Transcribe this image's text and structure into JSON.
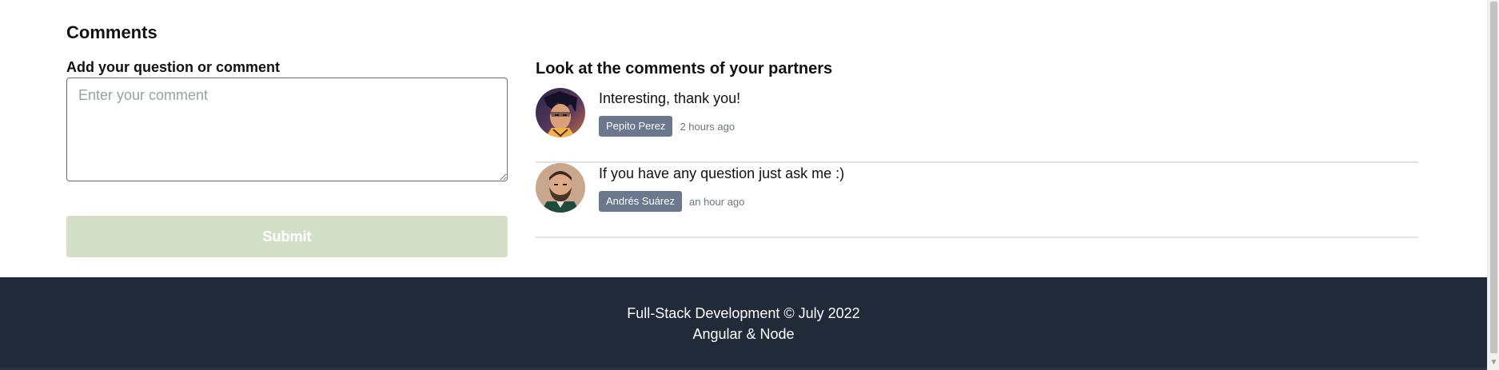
{
  "section": {
    "title": "Comments"
  },
  "form": {
    "label": "Add your question or comment",
    "placeholder": "Enter your comment",
    "value": "",
    "submit_label": "Submit"
  },
  "comments": {
    "heading": "Look at the comments of your partners",
    "items": [
      {
        "text": "Interesting, thank you!",
        "author": "Pepito Perez",
        "time": "2 hours ago",
        "avatar": "illustrated-character-avatar"
      },
      {
        "text": "If you have any question just ask me :)",
        "author": "Andrés Suárez",
        "time": "an hour ago",
        "avatar": "bearded-man-avatar"
      }
    ]
  },
  "footer": {
    "line1": "Full-Stack Development © July 2022",
    "line2": "Angular & Node"
  },
  "colors": {
    "submit_disabled_bg": "#d3e0c7",
    "author_badge_bg": "#6b778d",
    "footer_bg": "#212a38"
  }
}
